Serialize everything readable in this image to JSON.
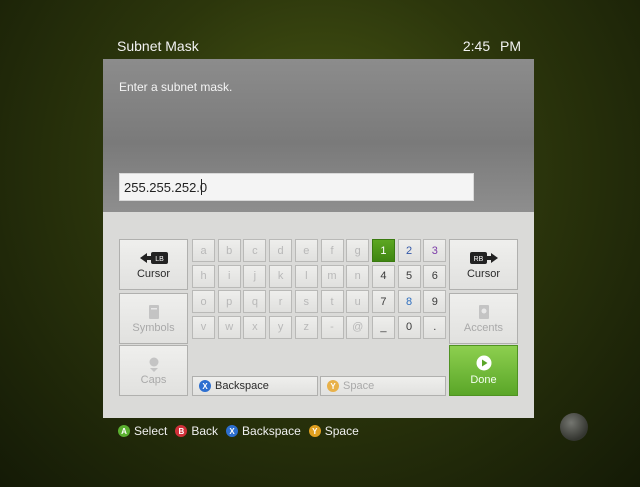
{
  "header": {
    "title": "Subnet Mask",
    "clock": "2:45 PM"
  },
  "prompt": "Enter a subnet mask.",
  "field": {
    "value": "255.255.252.0"
  },
  "keyboard": {
    "left": [
      {
        "label": "Cursor",
        "icon": "lb-arrow-left-icon"
      },
      {
        "label": "Symbols",
        "icon": "symbols-icon"
      },
      {
        "label": "Caps",
        "icon": "caps-icon"
      }
    ],
    "right": [
      {
        "label": "Cursor",
        "icon": "rb-arrow-right-icon"
      },
      {
        "label": "Accents",
        "icon": "accents-icon"
      }
    ],
    "rows": [
      [
        "a",
        "b",
        "c",
        "d",
        "e",
        "f",
        "g",
        "1",
        "2",
        "3"
      ],
      [
        "h",
        "i",
        "j",
        "k",
        "l",
        "m",
        "n",
        "4",
        "5",
        "6"
      ],
      [
        "o",
        "p",
        "q",
        "r",
        "s",
        "t",
        "u",
        "7",
        "8",
        "9"
      ],
      [
        "v",
        "w",
        "x",
        "y",
        "z",
        "-",
        "@",
        "_",
        "0",
        "."
      ]
    ],
    "selected_key": "1",
    "backspace": "Backspace",
    "space": "Space",
    "done": "Done"
  },
  "footer": [
    {
      "button": "A",
      "color": "#5bb030",
      "label": "Select"
    },
    {
      "button": "B",
      "color": "#d0303a",
      "label": "Back"
    },
    {
      "button": "X",
      "color": "#2d6fd0",
      "label": "Backspace"
    },
    {
      "button": "Y",
      "color": "#e0a020",
      "label": "Space"
    }
  ],
  "colors": {
    "accent_green": "#5da722",
    "done_green": "#7cc244"
  }
}
